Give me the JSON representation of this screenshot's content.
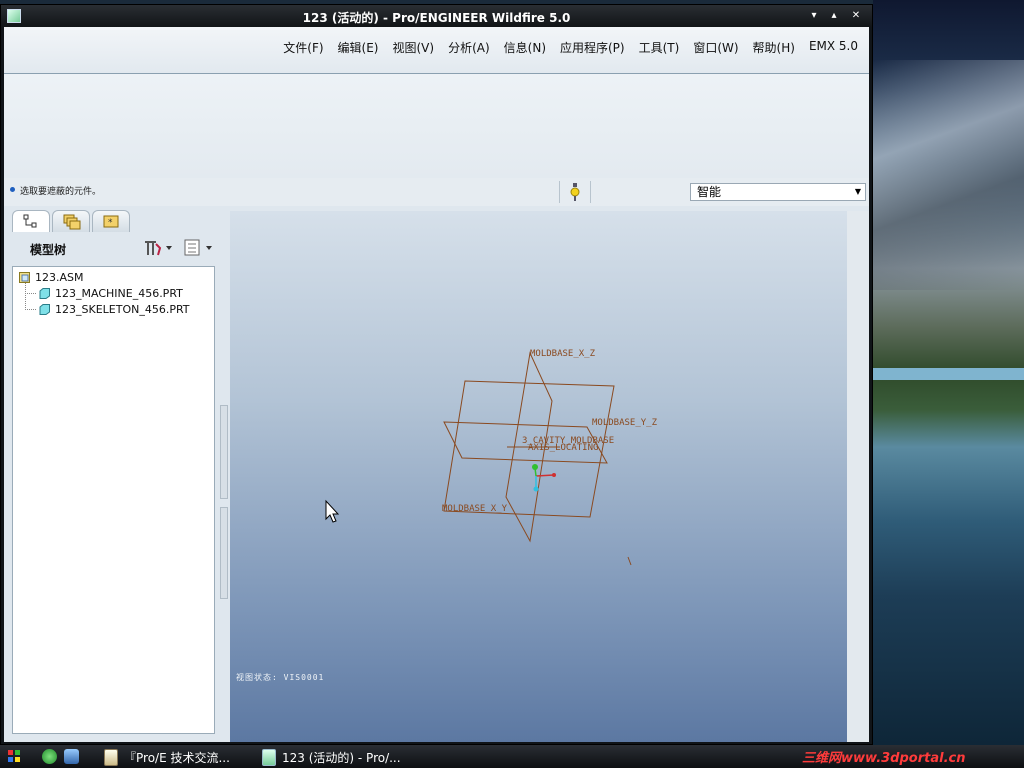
{
  "window": {
    "title": "123 (活动的) - Pro/ENGINEER Wildfire 5.0",
    "controls": {
      "minimize": "▾",
      "maximize": "▴",
      "close": "✕"
    }
  },
  "menu": {
    "items": [
      "文件(F)",
      "编辑(E)",
      "视图(V)",
      "分析(A)",
      "信息(N)",
      "应用程序(P)",
      "工具(T)",
      "窗口(W)",
      "帮助(H)",
      "EMX 5.0"
    ]
  },
  "status": {
    "message": "选取要遮蔽的元件。",
    "filter_value": "智能"
  },
  "navigator": {
    "title": "模型树",
    "tree": [
      {
        "label": "123.ASM",
        "level": 0
      },
      {
        "label": "123_MACHINE_456.PRT",
        "level": 1
      },
      {
        "label": "123_SKELETON_456.PRT",
        "level": 1
      }
    ]
  },
  "graphics": {
    "datum_labels": {
      "xz": "MOLDBASE_X_Z",
      "yz": "MOLDBASE_Y_Z",
      "xy": "MOLDBASE_X_Y",
      "cavity": "3_CAVITY_MOLDBASE",
      "axis": "AXIS_LOCATING"
    },
    "view_label": "视图状态: VIS0001"
  },
  "taskbar": {
    "items": [
      "『Pro/E 技术交流...",
      "123 (活动的) - Pro/..."
    ],
    "brand": "三维网www.3dportal.cn"
  },
  "colors": {
    "datum": "#8a4a20",
    "titlebar": "#1a1d21",
    "accent": "#1f5fbf"
  }
}
